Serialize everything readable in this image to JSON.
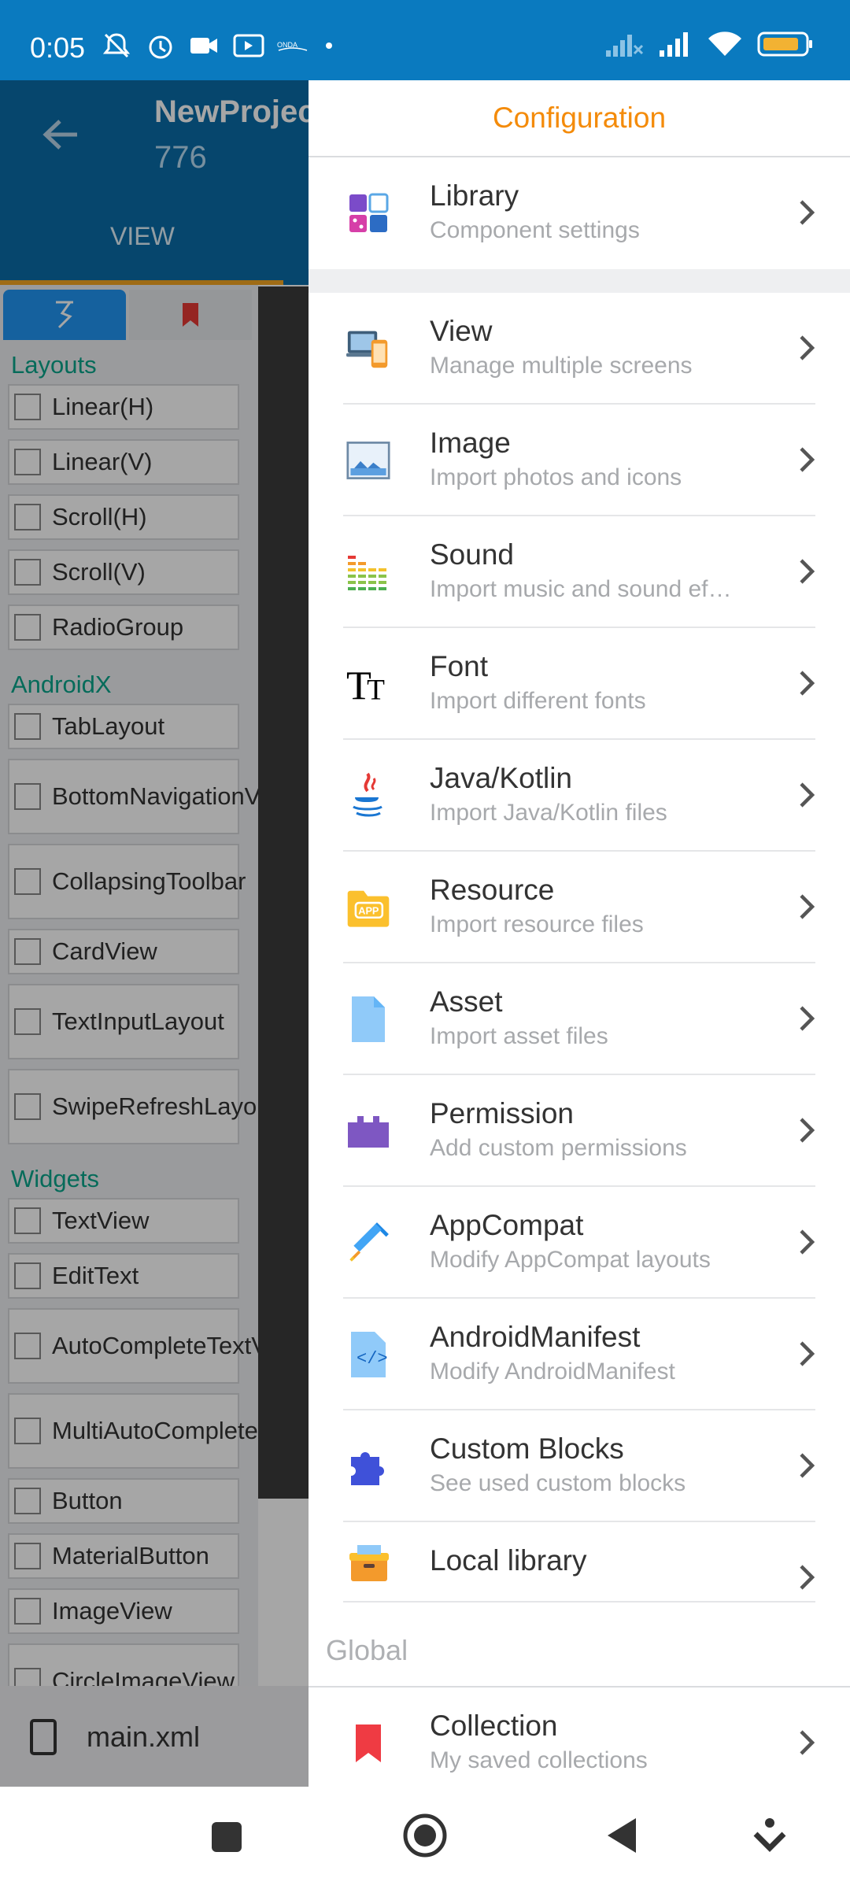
{
  "status_bar": {
    "time": "0:05"
  },
  "background_app": {
    "project_title": "NewProjec",
    "project_id": "776",
    "view_tab": "VIEW",
    "sections": {
      "layouts": "Layouts",
      "androidx": "AndroidX",
      "widgets": "Widgets"
    },
    "layouts": [
      "Linear(H)",
      "Linear(V)",
      "Scroll(H)",
      "Scroll(V)",
      "RadioGroup"
    ],
    "androidx": [
      "TabLayout",
      "BottomNavigationView",
      "CollapsingToolbar",
      "CardView",
      "TextInputLayout",
      "SwipeRefreshLayout"
    ],
    "widgets": [
      "TextView",
      "EditText",
      "AutoCompleteTextView",
      "MultiAutoCompleteTextView",
      "Button",
      "MaterialButton",
      "ImageView",
      "CircleImageView"
    ],
    "file_name": "main.xml"
  },
  "drawer": {
    "title": "Configuration",
    "items": [
      {
        "title": "Library",
        "subtitle": "Component settings",
        "icon": "library-icon"
      },
      {
        "title": "View",
        "subtitle": "Manage multiple screens",
        "icon": "devices-icon"
      },
      {
        "title": "Image",
        "subtitle": "Import photos and icons",
        "icon": "image-icon"
      },
      {
        "title": "Sound",
        "subtitle": "Import music and sound ef…",
        "icon": "equalizer-icon"
      },
      {
        "title": "Font",
        "subtitle": "Import different fonts",
        "icon": "font-icon"
      },
      {
        "title": "Java/Kotlin",
        "subtitle": "Import Java/Kotlin files",
        "icon": "java-icon"
      },
      {
        "title": "Resource",
        "subtitle": "Import resource files",
        "icon": "apk-folder-icon"
      },
      {
        "title": "Asset",
        "subtitle": "Import asset files",
        "icon": "file-icon"
      },
      {
        "title": "Permission",
        "subtitle": "Add custom permissions",
        "icon": "permission-icon"
      },
      {
        "title": "AppCompat",
        "subtitle": "Modify AppCompat layouts",
        "icon": "syringe-icon"
      },
      {
        "title": "AndroidManifest",
        "subtitle": "Modify AndroidManifest",
        "icon": "code-file-icon"
      },
      {
        "title": "Custom Blocks",
        "subtitle": "See used custom blocks",
        "icon": "puzzle-icon"
      },
      {
        "title": "Local library",
        "subtitle": "",
        "icon": "box-icon"
      }
    ],
    "global_section": "Global",
    "global_items": [
      {
        "title": "Collection",
        "subtitle": "My saved collections",
        "icon": "bookmark-icon"
      }
    ]
  },
  "colors": {
    "status_bar": "#0A7ABF",
    "toolbar": "#0A6CA8",
    "drawer_title": "#F48B0A",
    "section_green": "#0AA58B"
  }
}
